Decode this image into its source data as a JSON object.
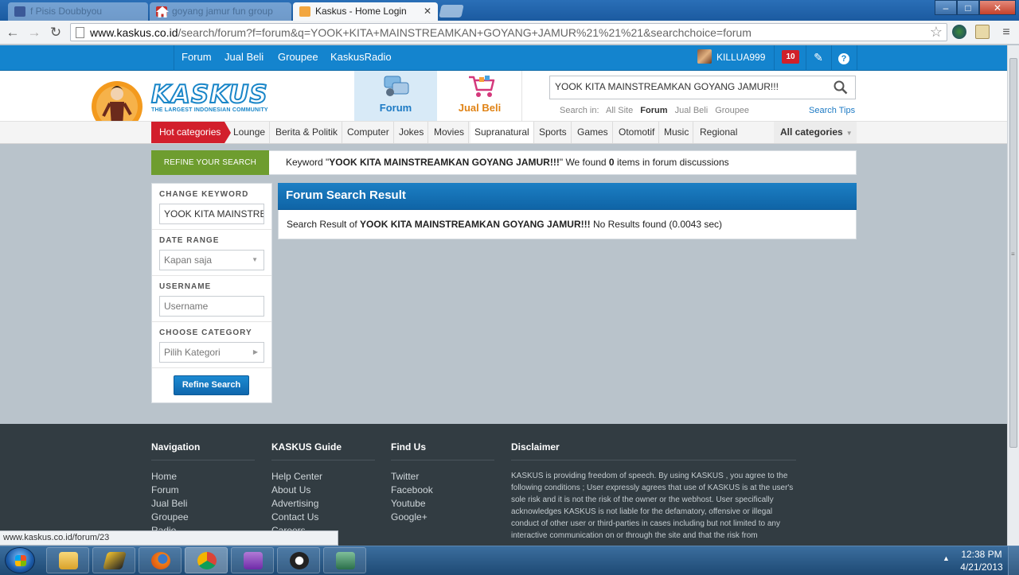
{
  "browser": {
    "tabs": [
      {
        "label": "f Pisis Doubbyou"
      },
      {
        "label": "goyang jamur fun group"
      },
      {
        "label": "Kaskus - Home Login"
      }
    ],
    "url_domain": "www.kaskus.co.id",
    "url_path": "/search/forum?f=forum&q=YOOK+KITA+MAINSTREAMKAN+GOYANG+JAMUR%21%21%21&searchchoice=forum",
    "status_url": "www.kaskus.co.id/forum/23"
  },
  "topbar": {
    "links": [
      "Forum",
      "Jual Beli",
      "Groupee",
      "KaskusRadio"
    ],
    "username": "KILLUA999",
    "notifications": "10"
  },
  "header": {
    "logo_text": "KASKUS",
    "logo_tagline": "THE LARGEST INDONESIAN COMMUNITY",
    "nav_forum": "Forum",
    "nav_jualbeli": "Jual Beli",
    "search_value": "YOOK KITA MAINSTREAMKAN GOYANG JAMUR!!!",
    "search_in_label": "Search in:",
    "search_in_options": [
      "All Site",
      "Forum",
      "Jual Beli",
      "Groupee"
    ],
    "search_tips": "Search Tips"
  },
  "categories": {
    "hot": "Hot categories",
    "items": [
      "Lounge",
      "Berita & Politik",
      "Computer",
      "Jokes",
      "Movies",
      "Supranatural",
      "Sports",
      "Games",
      "Otomotif",
      "Music",
      "Regional"
    ],
    "all": "All categories"
  },
  "refine": {
    "button": "REFINE YOUR SEARCH",
    "kw_prefix": "Keyword \"",
    "kw_value": "YOOK KITA MAINSTREAMKAN GOYANG JAMUR!!!",
    "kw_mid": "\" We found ",
    "kw_count": "0",
    "kw_suffix": " items in forum discussions"
  },
  "sidebar": {
    "change_keyword_label": "CHANGE KEYWORD",
    "change_keyword_value": "YOOK KITA MAINSTREAMKAN GOYANG JAMUR!!!",
    "date_range_label": "DATE RANGE",
    "date_range_value": "Kapan saja",
    "username_label": "USERNAME",
    "username_placeholder": "Username",
    "category_label": "CHOOSE CATEGORY",
    "category_value": "Pilih Kategori",
    "submit": "Refine Search"
  },
  "results": {
    "title": "Forum Search Result",
    "prefix": "Search Result of ",
    "query": "YOOK KITA MAINSTREAMKAN GOYANG JAMUR!!!",
    "suffix": " No Results found (0.0043 sec)"
  },
  "footer": {
    "navigation": {
      "title": "Navigation",
      "links": [
        "Home",
        "Forum",
        "Jual Beli",
        "Groupee",
        "Radio"
      ]
    },
    "guide": {
      "title": "KASKUS Guide",
      "links": [
        "Help Center",
        "About Us",
        "Advertising",
        "Contact Us",
        "Careers"
      ]
    },
    "findus": {
      "title": "Find Us",
      "links": [
        "Twitter",
        "Facebook",
        "Youtube",
        "Google+"
      ]
    },
    "disclaimer": {
      "title": "Disclaimer",
      "text": "KASKUS is providing freedom of speech. By using KASKUS , you agree to the following conditions ; User expressly agrees that use of KASKUS is at the user's sole risk and it is not the risk of the owner or the webhost. User specifically acknowledges KASKUS is not liable for the defamatory, offensive or illegal conduct of other user or third-parties in cases including but not limited to any interactive communication on or through the site and that the risk from"
    }
  },
  "taskbar": {
    "time": "12:38 PM",
    "date": "4/21/2013"
  },
  "colors": {
    "brand_blue": "#1484ce",
    "hot_red": "#d21f2c",
    "refine_green": "#6e9d2f",
    "footer_dark": "#323c42"
  }
}
